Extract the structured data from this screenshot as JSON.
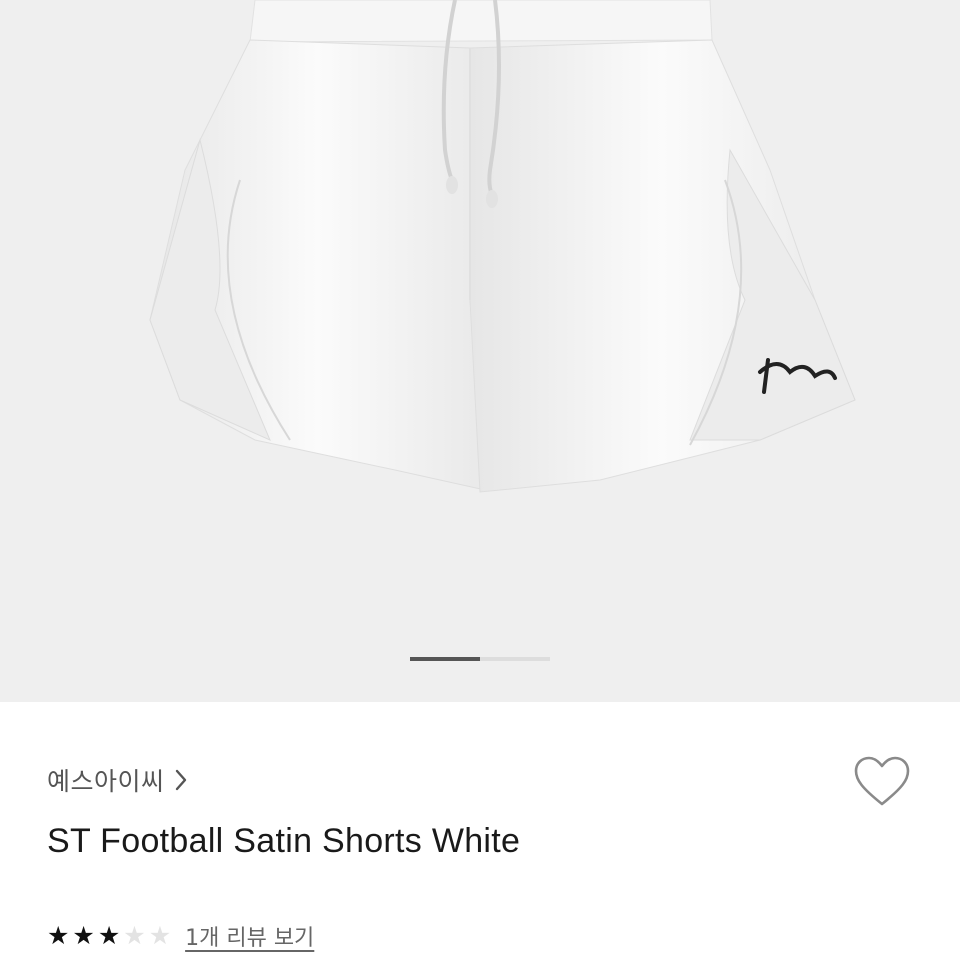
{
  "gallery": {
    "slide_count": 2,
    "active_slide": 1,
    "logo_script_text": "Yess"
  },
  "product": {
    "brand": "예스아이씨",
    "name": "ST Football Satin Shorts White",
    "rating": 3,
    "rating_max": 5,
    "review_link": "1개 리뷰 보기"
  },
  "icons": {
    "brand_chevron": "chevron-right-icon",
    "wishlist": "heart-outline-icon",
    "star": "star-icon"
  },
  "colors": {
    "hero_background": "#efefef",
    "star_filled": "#111111",
    "star_empty": "#e3e3e3",
    "pager_active": "#555555"
  }
}
